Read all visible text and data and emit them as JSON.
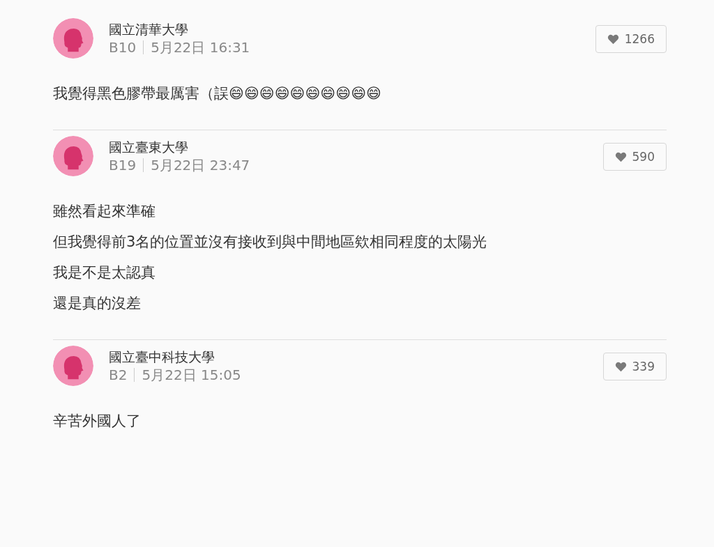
{
  "comments": [
    {
      "school": "國立清華大學",
      "floor": "B10",
      "time": "5月22日 16:31",
      "likes": "1266",
      "lines": [
        "我覺得黑色膠帶最厲害（誤😄😄😄😄😄😄😄😄😄😄"
      ]
    },
    {
      "school": "國立臺東大學",
      "floor": "B19",
      "time": "5月22日 23:47",
      "likes": "590",
      "lines": [
        "雖然看起來準確",
        "但我覺得前3名的位置並沒有接收到與中間地區欸相同程度的太陽光",
        "我是不是太認真",
        "還是真的沒差"
      ]
    },
    {
      "school": "國立臺中科技大學",
      "floor": "B2",
      "time": "5月22日 15:05",
      "likes": "339",
      "lines": [
        "辛苦外國人了"
      ]
    }
  ]
}
